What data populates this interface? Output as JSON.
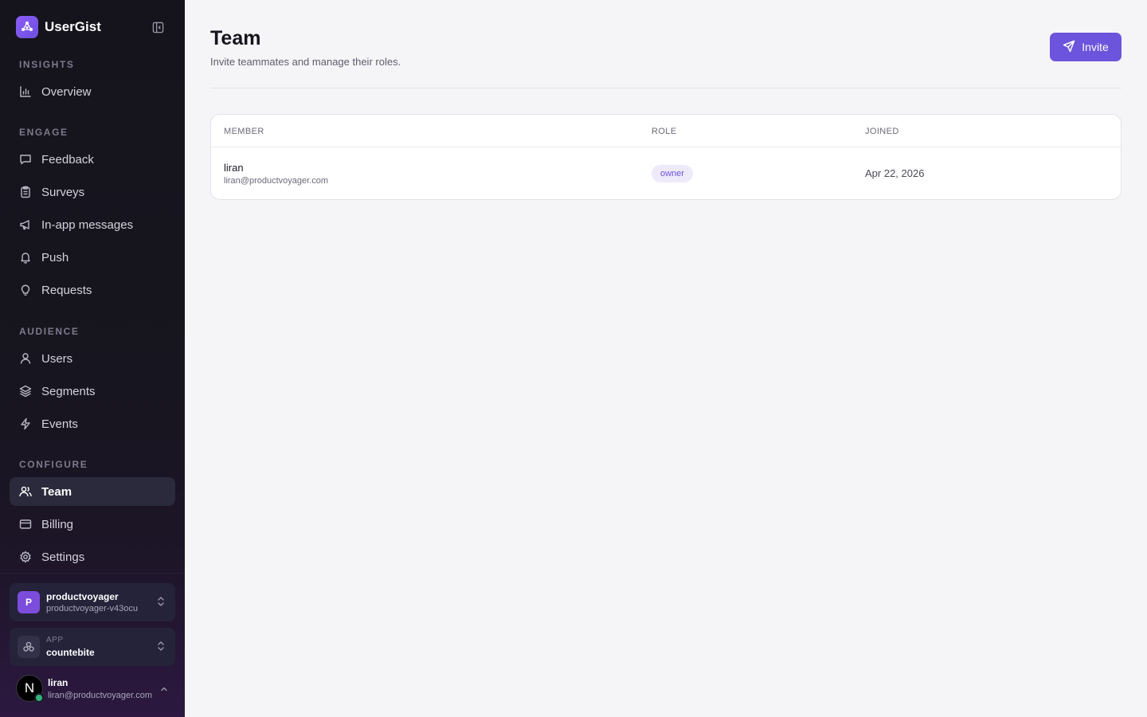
{
  "brand": {
    "name": "UserGist"
  },
  "sidebar": {
    "sections": [
      {
        "label": "INSIGHTS",
        "items": [
          {
            "label": "Overview",
            "icon": "bar-chart-icon"
          }
        ]
      },
      {
        "label": "ENGAGE",
        "items": [
          {
            "label": "Feedback",
            "icon": "message-square-icon"
          },
          {
            "label": "Surveys",
            "icon": "clipboard-icon"
          },
          {
            "label": "In-app messages",
            "icon": "megaphone-icon"
          },
          {
            "label": "Push",
            "icon": "bell-icon"
          },
          {
            "label": "Requests",
            "icon": "lightbulb-icon"
          }
        ]
      },
      {
        "label": "AUDIENCE",
        "items": [
          {
            "label": "Users",
            "icon": "user-icon"
          },
          {
            "label": "Segments",
            "icon": "layers-icon"
          },
          {
            "label": "Events",
            "icon": "zap-icon"
          }
        ]
      },
      {
        "label": "CONFIGURE",
        "items": [
          {
            "label": "Team",
            "icon": "users-icon",
            "active": true
          },
          {
            "label": "Billing",
            "icon": "credit-card-icon"
          },
          {
            "label": "Settings",
            "icon": "gear-icon"
          }
        ]
      }
    ],
    "org": {
      "initial": "P",
      "name": "productvoyager",
      "slug": "productvoyager-v43ocu"
    },
    "app": {
      "kicker": "APP",
      "name": "countebite"
    },
    "user": {
      "initial": "N",
      "name": "liran",
      "email": "liran@productvoyager.com"
    }
  },
  "page": {
    "title": "Team",
    "subtitle": "Invite teammates and manage their roles.",
    "invite_label": "Invite"
  },
  "table": {
    "columns": [
      "MEMBER",
      "ROLE",
      "JOINED"
    ],
    "rows": [
      {
        "name": "liran",
        "email": "liran@productvoyager.com",
        "role": "owner",
        "joined": "Apr 22, 2026"
      }
    ]
  },
  "colors": {
    "accent": "#6d54dc",
    "sidebar_bg": "#15141c",
    "active_item_bg": "#2b2a3c",
    "online": "#2fb37a"
  }
}
